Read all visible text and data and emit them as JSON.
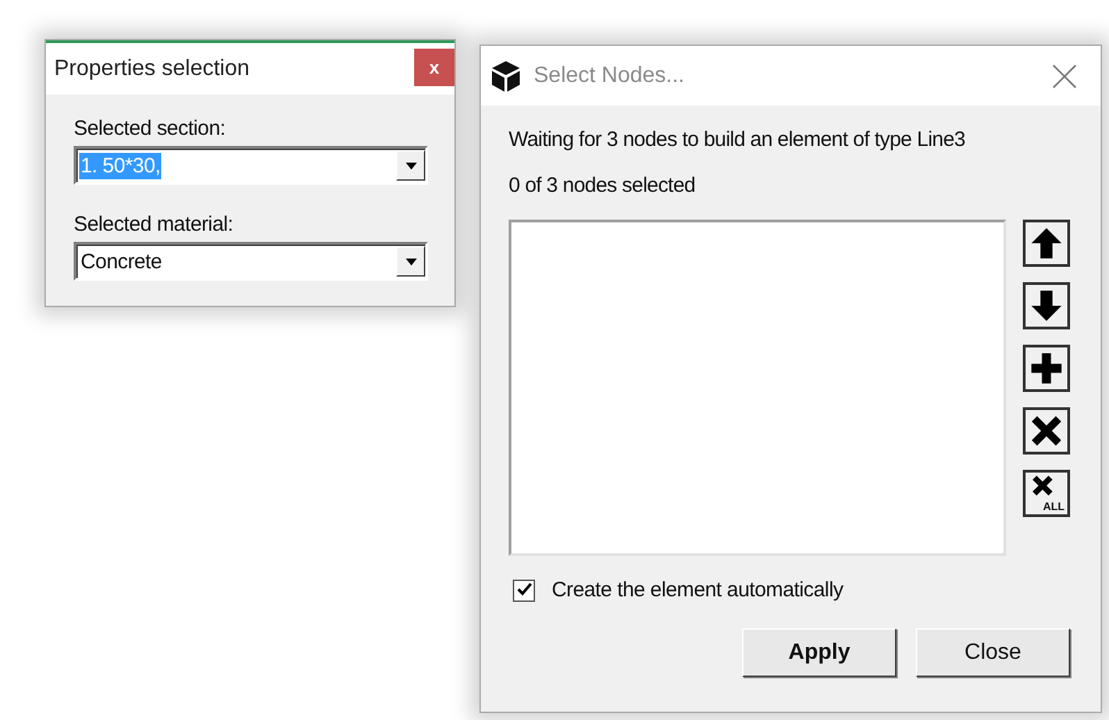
{
  "properties_window": {
    "title": "Properties selection",
    "close": "x",
    "fields": [
      {
        "label": "Selected section:",
        "value": "1. 50*30,",
        "selected": true
      },
      {
        "label": "Selected material:",
        "value": "Concrete",
        "selected": false
      }
    ]
  },
  "nodes_window": {
    "title": "Select Nodes...",
    "active": false,
    "message": "Waiting for 3 nodes to build an element of type Line3",
    "count": "0 of 3 nodes selected",
    "side_buttons": [
      {
        "kind": "up"
      },
      {
        "kind": "down"
      },
      {
        "kind": "add"
      },
      {
        "kind": "remove"
      },
      {
        "kind": "remove_all",
        "label": "ALL"
      }
    ],
    "auto_create": {
      "label": "Create the element automatically",
      "checked": true
    },
    "buttons": [
      {
        "label": "Apply",
        "default": true
      },
      {
        "label": "Close",
        "default": false
      }
    ]
  }
}
